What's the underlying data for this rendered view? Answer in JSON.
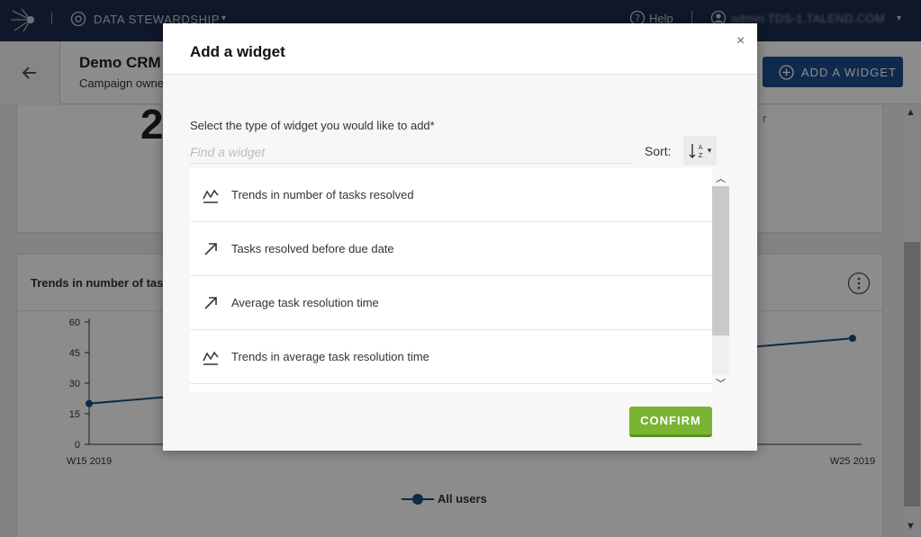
{
  "topbar": {
    "app_name": "DATA STEWARDSHIP",
    "help_label": "Help",
    "user_name": "admin TDS-1.TALEND.COM"
  },
  "subheader": {
    "title": "Demo CRM c",
    "subtitle": "Campaign owne",
    "add_widget_label": "ADD A WIDGET"
  },
  "dashboard": {
    "big_number": "2",
    "red_tag": "r",
    "card_title": "Trends in number of task"
  },
  "chart_data": {
    "type": "line",
    "x_start_label": "W15 2019",
    "x_end_label": "W25 2019",
    "y_ticks": [
      0,
      15,
      30,
      45,
      60
    ],
    "ylim": [
      0,
      60
    ],
    "series": [
      {
        "name": "All users",
        "color": "#1a4d80",
        "points": [
          {
            "x": "W15 2019",
            "y": 20
          },
          {
            "x": "W25 2019",
            "y": 52
          }
        ]
      }
    ],
    "legend_position": "bottom"
  },
  "modal": {
    "title": "Add a widget",
    "close_glyph": "×",
    "select_label": "Select the type of widget you would like to add*",
    "search_placeholder": "Find a widget",
    "search_value": "",
    "sort_label": "Sort:",
    "confirm_label": "CONFIRM",
    "widgets": [
      {
        "icon": "trend-chart-icon",
        "label": "Trends in number of tasks resolved"
      },
      {
        "icon": "arrow-up-right-icon",
        "label": "Tasks resolved before due date"
      },
      {
        "icon": "arrow-up-right-icon",
        "label": "Average task resolution time"
      },
      {
        "icon": "trend-chart-icon",
        "label": "Trends in average task resolution time"
      }
    ]
  },
  "colors": {
    "topbar": "#1c2d4c",
    "primary_button": "#1e4d8c",
    "confirm_button": "#7ab432",
    "series_line": "#1a4d80"
  }
}
